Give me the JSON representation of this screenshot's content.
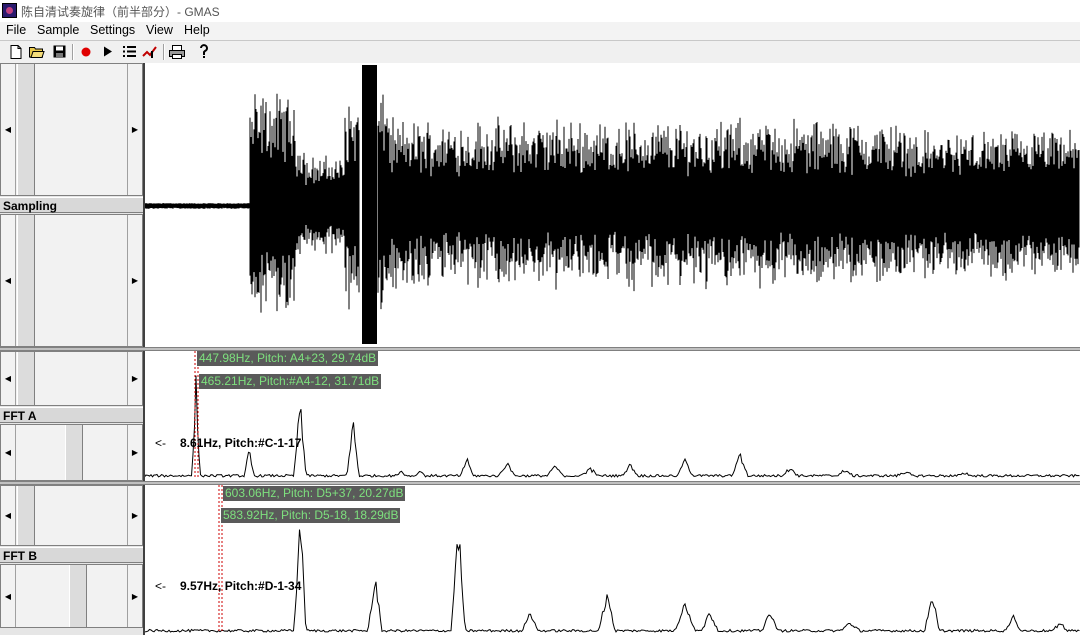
{
  "window": {
    "title": "陈自清试奏旋律（前半部分）- GMAS"
  },
  "menu": {
    "items": [
      "File",
      "Sample",
      "Settings",
      "View",
      "Help"
    ]
  },
  "toolbar": {
    "icons": [
      "new-file-icon",
      "open-folder-icon",
      "save-icon",
      "record-icon",
      "play-icon",
      "list-icon",
      "marker-icon",
      "print-icon",
      "help-icon"
    ]
  },
  "panels": {
    "sampling": {
      "label": "Sampling"
    },
    "fft_a": {
      "label": "FFT A",
      "peak1": "447.98Hz, Pitch: A4+23,  29.74dB",
      "peak2": "465.21Hz, Pitch:#A4-12,  31.71dB",
      "cursor": "8.61Hz, Pitch:#C-1-17",
      "arrow": "<-"
    },
    "fft_b": {
      "label": "FFT B",
      "peak1": "603.06Hz, Pitch: D5+37,  20.27dB",
      "peak2": "583.92Hz, Pitch: D5-18,  18.29dB",
      "cursor": "9.57Hz, Pitch:#D-1-34",
      "arrow": "<-"
    }
  },
  "colors": {
    "waveform": "#000000",
    "label_bg": "#5a5a5a",
    "label_text": "#7ee07e",
    "marker": "#cc0000"
  }
}
